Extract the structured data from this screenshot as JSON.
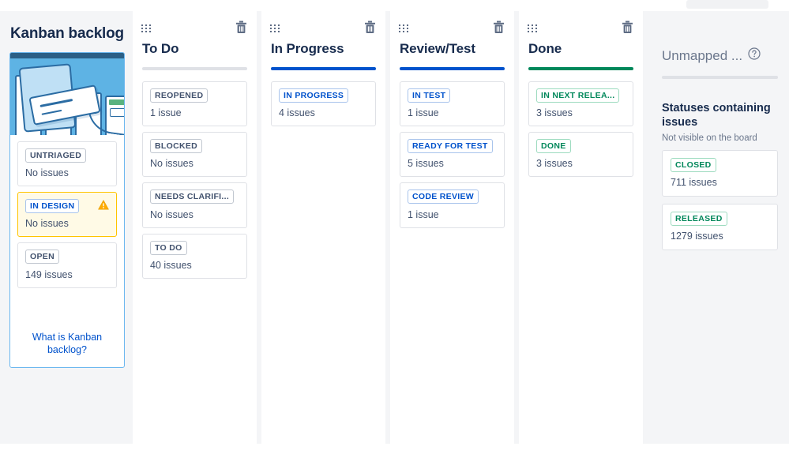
{
  "backlog": {
    "title": "Kanban backlog",
    "illustration_name": "kanban-board-illustration",
    "statuses": [
      {
        "label": "UNTRIAGED",
        "count": "No issues",
        "tone": "grey",
        "warning": false
      },
      {
        "label": "IN DESIGN",
        "count": "No issues",
        "tone": "blue",
        "warning": true
      },
      {
        "label": "OPEN",
        "count": "149 issues",
        "tone": "grey",
        "warning": false
      }
    ],
    "link": "What is Kanban backlog?"
  },
  "columns": [
    {
      "title": "To Do",
      "rule": "grey",
      "drag_icon": "drag-handle-icon",
      "delete_icon": "trash-icon",
      "statuses": [
        {
          "label": "REOPENED",
          "count": "1 issue",
          "tone": "grey"
        },
        {
          "label": "BLOCKED",
          "count": "No issues",
          "tone": "grey"
        },
        {
          "label": "NEEDS CLARIFI...",
          "count": "No issues",
          "tone": "grey"
        },
        {
          "label": "TO DO",
          "count": "40 issues",
          "tone": "grey"
        }
      ]
    },
    {
      "title": "In Progress",
      "rule": "blue",
      "drag_icon": "drag-handle-icon",
      "delete_icon": "trash-icon",
      "statuses": [
        {
          "label": "IN PROGRESS",
          "count": "4 issues",
          "tone": "blue"
        }
      ]
    },
    {
      "title": "Review/Test",
      "rule": "blue",
      "drag_icon": "drag-handle-icon",
      "delete_icon": "trash-icon",
      "statuses": [
        {
          "label": "IN TEST",
          "count": "1 issue",
          "tone": "blue"
        },
        {
          "label": "READY FOR TEST",
          "count": "5 issues",
          "tone": "blue"
        },
        {
          "label": "CODE REVIEW",
          "count": "1 issue",
          "tone": "blue"
        }
      ]
    },
    {
      "title": "Done",
      "rule": "green",
      "drag_icon": "drag-handle-icon",
      "delete_icon": "trash-icon",
      "statuses": [
        {
          "label": "IN NEXT RELEA...",
          "count": "3 issues",
          "tone": "green"
        },
        {
          "label": "DONE",
          "count": "3 issues",
          "tone": "green"
        }
      ]
    }
  ],
  "unmapped": {
    "title": "Unmapped ...",
    "help_icon": "help-circle-icon",
    "subtitle": "Statuses containing issues",
    "note": "Not visible on the board",
    "statuses": [
      {
        "label": "CLOSED",
        "count": "711 issues",
        "tone": "green"
      },
      {
        "label": "RELEASED",
        "count": "1279 issues",
        "tone": "green"
      }
    ]
  },
  "colors": {
    "page_bg": "#f4f5f7",
    "column_bg": "#ffffff",
    "text_primary": "#172b4d",
    "text_subtle": "#6b778c",
    "blue": "#0052cc",
    "green": "#00875a",
    "grey_rule": "#dfe1e6",
    "warning": "#ffc400",
    "backlog_border": "#6cb7ef"
  }
}
